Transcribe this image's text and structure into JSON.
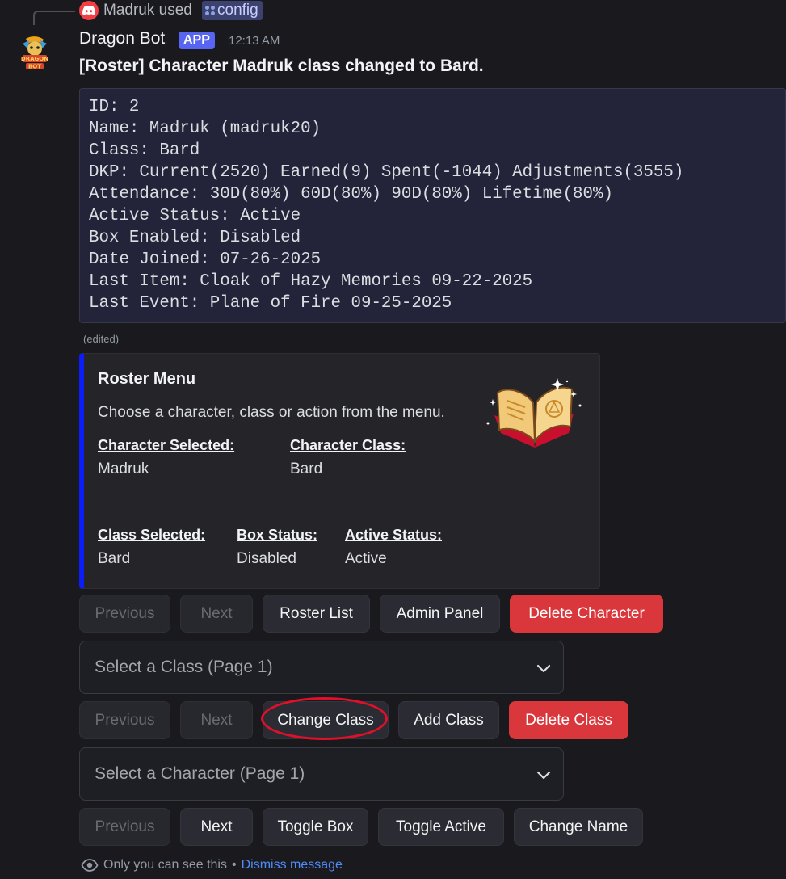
{
  "reply": {
    "user": "Madruk",
    "used_text": "used",
    "command": "config"
  },
  "message": {
    "author": "Dragon Bot",
    "badge": "APP",
    "timestamp": "12:13 AM",
    "title": "[Roster] Character Madruk class changed to Bard.",
    "code_lines": [
      "ID: 2",
      "Name: Madruk (madruk20)",
      "Class: Bard",
      "DKP: Current(2520) Earned(9) Spent(-1044) Adjustments(3555)",
      "Attendance: 30D(80%) 60D(80%) 90D(80%) Lifetime(80%)",
      "Active Status: Active",
      "Box Enabled: Disabled",
      "Date Joined: 07-26-2025",
      "Last Item: Cloak of Hazy Memories 09-22-2025",
      "Last Event: Plane of Fire 09-25-2025"
    ],
    "edited": "(edited)"
  },
  "embed": {
    "title": "Roster Menu",
    "description": "Choose a character, class or action from the menu.",
    "accent_color": "#0a1ef5",
    "fields": [
      {
        "name": "Character Selected:",
        "value": "Madruk"
      },
      {
        "name": "Character Class:",
        "value": "Bard"
      },
      {
        "name": "Class Selected:",
        "value": "Bard"
      },
      {
        "name": "Box Status:",
        "value": "Disabled"
      },
      {
        "name": "Active Status:",
        "value": "Active"
      }
    ]
  },
  "row1": {
    "previous": "Previous",
    "next": "Next",
    "roster_list": "Roster List",
    "admin_panel": "Admin Panel",
    "delete_character": "Delete Character"
  },
  "class_select": {
    "placeholder": "Select a Class (Page 1)"
  },
  "row2": {
    "previous": "Previous",
    "next": "Next",
    "change_class": "Change Class",
    "add_class": "Add Class",
    "delete_class": "Delete Class"
  },
  "character_select": {
    "placeholder": "Select a Character (Page 1)"
  },
  "row3": {
    "previous": "Previous",
    "next": "Next",
    "toggle_box": "Toggle Box",
    "toggle_active": "Toggle Active",
    "change_name": "Change Name"
  },
  "footer": {
    "notice": "Only you can see this",
    "separator": "•",
    "dismiss": "Dismiss message"
  },
  "colors": {
    "danger": "#da373c",
    "brand": "#5865f2",
    "link": "#4f8cf7",
    "highlight": "#e0102a"
  }
}
